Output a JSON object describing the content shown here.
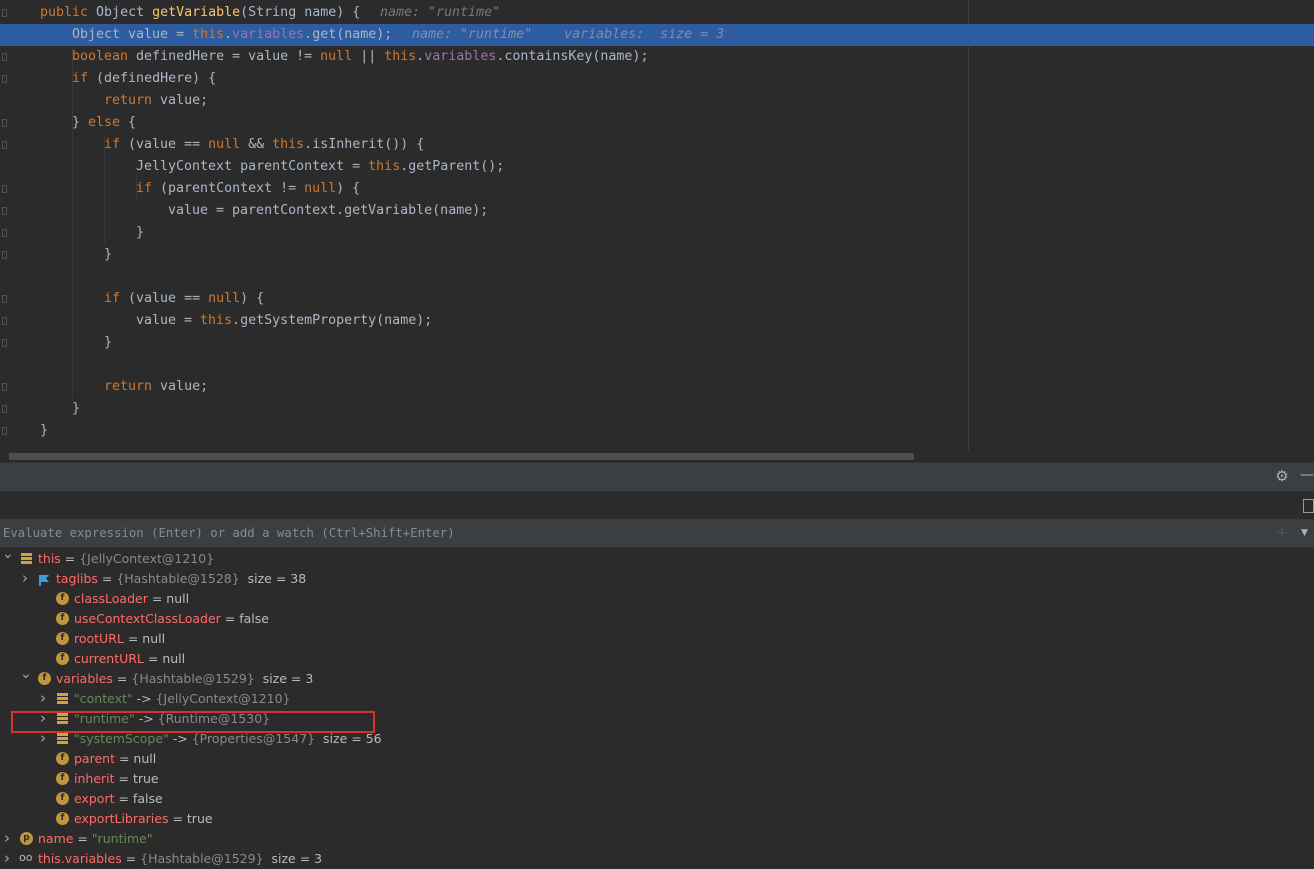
{
  "editor": {
    "lines": [
      {
        "tokens": [
          [
            "kw",
            "public "
          ],
          [
            "pl",
            "Object "
          ],
          [
            "fn",
            "getVariable"
          ],
          [
            "pl",
            "(String name) {"
          ]
        ],
        "hint": "name: \"runtime\""
      },
      {
        "tokens": [
          [
            "pl",
            "Object value = "
          ],
          [
            "kw",
            "this"
          ],
          [
            "pl",
            "."
          ],
          [
            "fld",
            "variables"
          ],
          [
            "pl",
            ".get(name);"
          ]
        ],
        "hint": "name: \"runtime\"    variables:  size = 3",
        "highlighted": true
      },
      {
        "tokens": [
          [
            "kw",
            "boolean "
          ],
          [
            "pl",
            "definedHere = value != "
          ],
          [
            "kw",
            "null"
          ],
          [
            "pl",
            " || "
          ],
          [
            "kw",
            "this"
          ],
          [
            "pl",
            "."
          ],
          [
            "fld",
            "variables"
          ],
          [
            "pl",
            ".containsKey(name);"
          ]
        ]
      },
      {
        "tokens": [
          [
            "kw",
            "if "
          ],
          [
            "pl",
            "(definedHere) {"
          ]
        ]
      },
      {
        "tokens": [
          [
            "kw",
            "return "
          ],
          [
            "pl",
            "value;"
          ]
        ]
      },
      {
        "tokens": [
          [
            "pl",
            "} "
          ],
          [
            "kw",
            "else "
          ],
          [
            "pl",
            "{"
          ]
        ]
      },
      {
        "tokens": [
          [
            "kw",
            "if "
          ],
          [
            "pl",
            "(value == "
          ],
          [
            "kw",
            "null"
          ],
          [
            "pl",
            " && "
          ],
          [
            "kw",
            "this"
          ],
          [
            "pl",
            ".isInherit()) {"
          ]
        ]
      },
      {
        "tokens": [
          [
            "pl",
            "JellyContext parentContext = "
          ],
          [
            "kw",
            "this"
          ],
          [
            "pl",
            ".getParent();"
          ]
        ]
      },
      {
        "tokens": [
          [
            "kw",
            "if "
          ],
          [
            "pl",
            "(parentContext != "
          ],
          [
            "kw",
            "null"
          ],
          [
            "pl",
            ") {"
          ]
        ]
      },
      {
        "tokens": [
          [
            "pl",
            "value = parentContext.getVariable(name);"
          ]
        ]
      },
      {
        "tokens": [
          [
            "pl",
            "}"
          ]
        ]
      },
      {
        "tokens": [
          [
            "pl",
            "}"
          ]
        ]
      },
      {
        "tokens": []
      },
      {
        "tokens": [
          [
            "kw",
            "if "
          ],
          [
            "pl",
            "(value == "
          ],
          [
            "kw",
            "null"
          ],
          [
            "pl",
            ") {"
          ]
        ]
      },
      {
        "tokens": [
          [
            "pl",
            "value = "
          ],
          [
            "kw",
            "this"
          ],
          [
            "pl",
            ".getSystemProperty(name);"
          ]
        ]
      },
      {
        "tokens": [
          [
            "pl",
            "}"
          ]
        ]
      },
      {
        "tokens": []
      },
      {
        "tokens": [
          [
            "kw",
            "return "
          ],
          [
            "pl",
            "value;"
          ]
        ]
      },
      {
        "tokens": [
          [
            "pl",
            "}"
          ]
        ]
      },
      {
        "tokens": [
          [
            "pl",
            "}"
          ]
        ]
      }
    ]
  },
  "debugger": {
    "eval_placeholder": "Evaluate expression (Enter) or add a watch (Ctrl+Shift+Enter)",
    "gear_icon": "⚙",
    "minimize_icon": "—",
    "add_watch_icon": "+",
    "dropdown_icon": "▼",
    "variables": [
      {
        "arrow": "v",
        "icon": "bars",
        "name": "this",
        "eq": " = ",
        "type": "{JellyContext@1210}",
        "value": ""
      },
      {
        "arrow": ">",
        "icon": "flag",
        "name": "taglibs",
        "eq": " = ",
        "type": "{Hashtable@1528}",
        "value": "  size = 38"
      },
      {
        "arrow": "",
        "icon": "f",
        "name": "classLoader",
        "eq": " = ",
        "type": "",
        "value": "null"
      },
      {
        "arrow": "",
        "icon": "f",
        "name": "useContextClassLoader",
        "eq": " = ",
        "type": "",
        "value": "false"
      },
      {
        "arrow": "",
        "icon": "f",
        "name": "rootURL",
        "eq": " = ",
        "type": "",
        "value": "null"
      },
      {
        "arrow": "",
        "icon": "f",
        "name": "currentURL",
        "eq": " = ",
        "type": "",
        "value": "null"
      },
      {
        "arrow": "v",
        "icon": "f",
        "name": "variables",
        "eq": " = ",
        "type": "{Hashtable@1529}",
        "value": "  size = 3"
      },
      {
        "arrow": ">",
        "icon": "bars",
        "key": "\"context\"",
        "eq": " -> ",
        "type": "{JellyContext@1210}",
        "value": ""
      },
      {
        "arrow": ">",
        "icon": "bars",
        "key": "\"runtime\"",
        "eq": " -> ",
        "type": "{Runtime@1530}",
        "value": ""
      },
      {
        "arrow": ">",
        "icon": "bars",
        "key": "\"systemScope\"",
        "eq": " -> ",
        "type": "{Properties@1547}",
        "value": "  size = 56"
      },
      {
        "arrow": "",
        "icon": "f",
        "name": "parent",
        "eq": " = ",
        "type": "",
        "value": "null"
      },
      {
        "arrow": "",
        "icon": "f",
        "name": "inherit",
        "eq": " = ",
        "type": "",
        "value": "true"
      },
      {
        "arrow": "",
        "icon": "f",
        "name": "export",
        "eq": " = ",
        "type": "",
        "value": "false"
      },
      {
        "arrow": "",
        "icon": "f",
        "name": "exportLibraries",
        "eq": " = ",
        "type": "",
        "value": "true"
      },
      {
        "arrow": ">",
        "icon": "p",
        "name": "name",
        "eq": " = ",
        "type": "",
        "value": "\"runtime\"",
        "value_is_string": true
      },
      {
        "arrow": ">",
        "icon": "glasses",
        "name": "this.variables",
        "eq": " = ",
        "type": "{Hashtable@1529}",
        "value": "  size = 3"
      }
    ]
  },
  "colors": {
    "selection": "#2d5ca0",
    "highlight_box": "#d9312b",
    "keyword": "#cc7832",
    "method": "#ffc66d",
    "field": "#9876aa",
    "var_name": "#ff6b68",
    "string": "#6a8759"
  }
}
